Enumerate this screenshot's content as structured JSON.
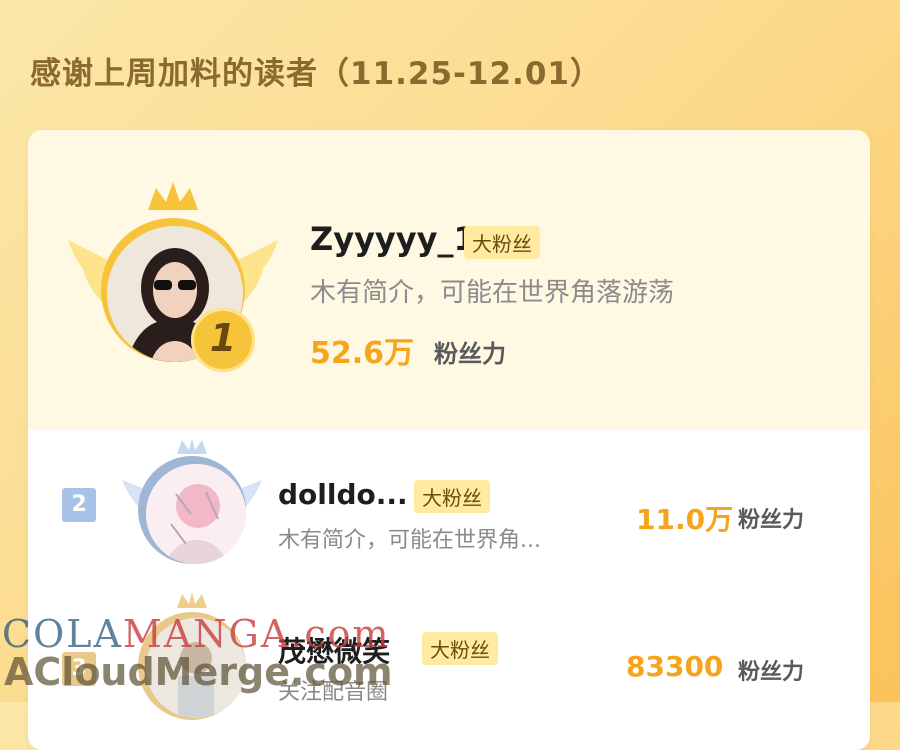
{
  "header": {
    "title": "感谢上周加料的读者（11.25-12.01）"
  },
  "readers": [
    {
      "rank": "1",
      "name": "Zyyyyy_1",
      "badge": "大粉丝",
      "desc": "木有简介，可能在世界角落游荡",
      "score": "52.6万",
      "score_label": "粉丝力"
    },
    {
      "rank": "2",
      "name": "dolldo...",
      "badge": "大粉丝",
      "desc": "木有简介，可能在世界角...",
      "score": "11.0万",
      "score_label": "粉丝力"
    },
    {
      "rank": "3",
      "name": "茂懋微笑",
      "badge": "大粉丝",
      "desc": "关注配音圈",
      "score": "83300",
      "score_label": "粉丝力"
    }
  ],
  "watermark": {
    "line1_a": "COLA",
    "line1_b": "MANGA",
    "line1_c": ".com",
    "line2": "ACloudMerge.com"
  },
  "colors": {
    "accent": "#f6a41b",
    "badge_bg": "#ffeaa0",
    "rank2": "#a6c2e6",
    "gold": "#f5c43a"
  }
}
